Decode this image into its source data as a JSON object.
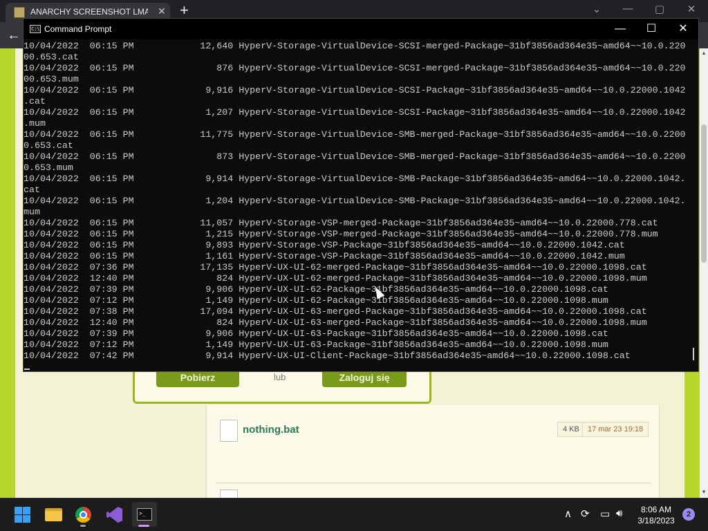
{
  "browser": {
    "tab_title": "ANARCHY SCREENSHOT LMAO -",
    "tab_close": "✕",
    "new_tab": "+"
  },
  "page": {
    "download_button": "Pobierz",
    "or_text": "lub",
    "login_button": "Zaloguj się",
    "file": {
      "name": "nothing.bat",
      "size": "4 KB",
      "date": "17 mar 23 19:18"
    }
  },
  "cmd": {
    "title": "Command Prompt",
    "lines": [
      "10/04/2022  06:15 PM            12,640 HyperV-Storage-VirtualDevice-SCSI-merged-Package~31bf3856ad364e35~amd64~~10.0.220",
      "00.653.cat",
      "10/04/2022  06:15 PM               876 HyperV-Storage-VirtualDevice-SCSI-merged-Package~31bf3856ad364e35~amd64~~10.0.220",
      "00.653.mum",
      "10/04/2022  06:15 PM             9,916 HyperV-Storage-VirtualDevice-SCSI-Package~31bf3856ad364e35~amd64~~10.0.22000.1042",
      ".cat",
      "10/04/2022  06:15 PM             1,207 HyperV-Storage-VirtualDevice-SCSI-Package~31bf3856ad364e35~amd64~~10.0.22000.1042",
      ".mum",
      "10/04/2022  06:15 PM            11,775 HyperV-Storage-VirtualDevice-SMB-merged-Package~31bf3856ad364e35~amd64~~10.0.2200",
      "0.653.cat",
      "10/04/2022  06:15 PM               873 HyperV-Storage-VirtualDevice-SMB-merged-Package~31bf3856ad364e35~amd64~~10.0.2200",
      "0.653.mum",
      "10/04/2022  06:15 PM             9,914 HyperV-Storage-VirtualDevice-SMB-Package~31bf3856ad364e35~amd64~~10.0.22000.1042.",
      "cat",
      "10/04/2022  06:15 PM             1,204 HyperV-Storage-VirtualDevice-SMB-Package~31bf3856ad364e35~amd64~~10.0.22000.1042.",
      "mum",
      "10/04/2022  06:15 PM            11,057 HyperV-Storage-VSP-merged-Package~31bf3856ad364e35~amd64~~10.0.22000.778.cat",
      "10/04/2022  06:15 PM             1,215 HyperV-Storage-VSP-merged-Package~31bf3856ad364e35~amd64~~10.0.22000.778.mum",
      "10/04/2022  06:15 PM             9,893 HyperV-Storage-VSP-Package~31bf3856ad364e35~amd64~~10.0.22000.1042.cat",
      "10/04/2022  06:15 PM             1,161 HyperV-Storage-VSP-Package~31bf3856ad364e35~amd64~~10.0.22000.1042.mum",
      "10/04/2022  07:36 PM            17,135 HyperV-UX-UI-62-merged-Package~31bf3856ad364e35~amd64~~10.0.22000.1098.cat",
      "10/04/2022  12:40 PM               824 HyperV-UX-UI-62-merged-Package~31bf3856ad364e35~amd64~~10.0.22000.1098.mum",
      "10/04/2022  07:39 PM             9,906 HyperV-UX-UI-62-Package~31bf3856ad364e35~amd64~~10.0.22000.1098.cat",
      "10/04/2022  07:12 PM             1,149 HyperV-UX-UI-62-Package~31bf3856ad364e35~amd64~~10.0.22000.1098.mum",
      "10/04/2022  07:38 PM            17,094 HyperV-UX-UI-63-merged-Package~31bf3856ad364e35~amd64~~10.0.22000.1098.cat",
      "10/04/2022  12:40 PM               824 HyperV-UX-UI-63-merged-Package~31bf3856ad364e35~amd64~~10.0.22000.1098.mum",
      "10/04/2022  07:39 PM             9,906 HyperV-UX-UI-63-Package~31bf3856ad364e35~amd64~~10.0.22000.1098.cat",
      "10/04/2022  07:12 PM             1,149 HyperV-UX-UI-63-Package~31bf3856ad364e35~amd64~~10.0.22000.1098.mum",
      "10/04/2022  07:42 PM             9,914 HyperV-UX-UI-Client-Package~31bf3856ad364e35~amd64~~10.0.22000.1098.cat"
    ]
  },
  "taskbar": {
    "time": "8:06 AM",
    "date": "3/18/2023",
    "notification_count": "2"
  },
  "colors": {
    "page_green": "#b7d62e",
    "button_green": "#7a9a1c",
    "file_link": "#2d7a57",
    "console_text": "#cccccc"
  }
}
